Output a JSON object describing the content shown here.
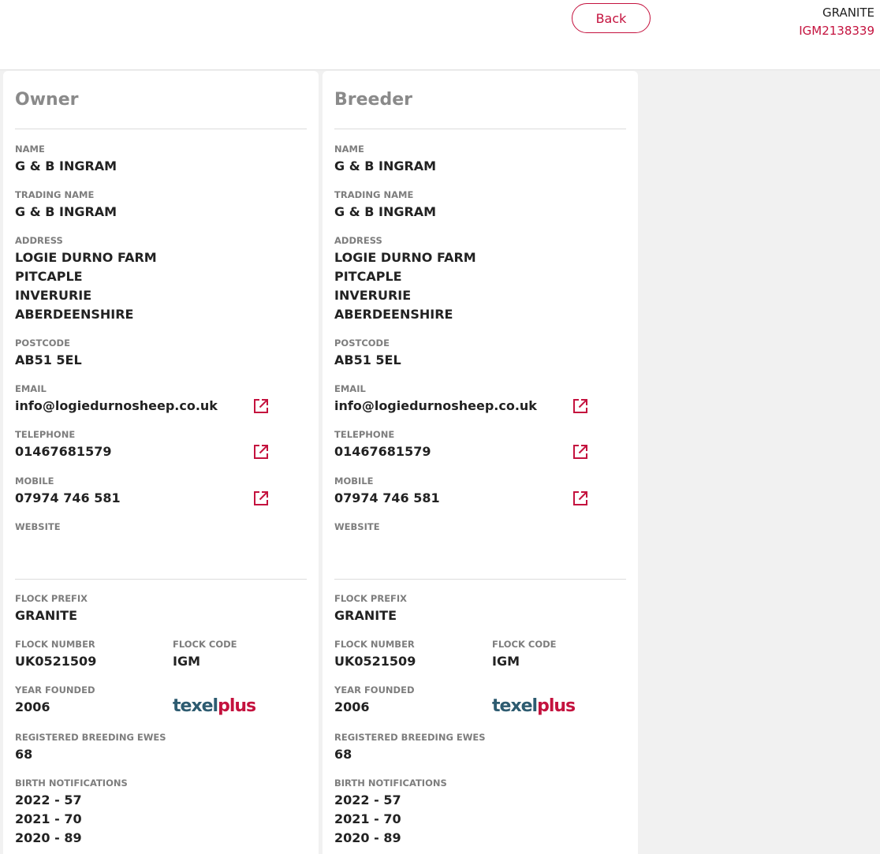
{
  "header": {
    "back_label": "Back",
    "animal_name": "GRANITE",
    "animal_id": "IGM2138339"
  },
  "labels": {
    "name": "NAME",
    "trading_name": "TRADING NAME",
    "address": "ADDRESS",
    "postcode": "POSTCODE",
    "email": "EMAIL",
    "telephone": "TELEPHONE",
    "mobile": "MOBILE",
    "website": "WEBSITE",
    "flock_prefix": "FLOCK PREFIX",
    "flock_number": "FLOCK NUMBER",
    "flock_code": "FLOCK CODE",
    "year_founded": "YEAR FOUNDED",
    "registered_breeding_ewes": "REGISTERED BREEDING EWES",
    "birth_notifications": "BIRTH NOTIFICATIONS"
  },
  "owner": {
    "title": "Owner",
    "name": "G & B INGRAM",
    "trading_name": "G & B INGRAM",
    "address": [
      "LOGIE DURNO FARM",
      "PITCAPLE",
      "INVERURIE",
      "ABERDEENSHIRE"
    ],
    "postcode": "AB51 5EL",
    "email": "info@logiedurnosheep.co.uk",
    "telephone": "01467681579",
    "mobile": "07974 746 581",
    "website": "",
    "flock_prefix": "GRANITE",
    "flock_number": "UK0521509",
    "flock_code": "IGM",
    "year_founded": "2006",
    "logo_text_a": "texel",
    "logo_text_b": "plus",
    "registered_breeding_ewes": "68",
    "birth_notifications": [
      "2022 - 57",
      "2021 - 70",
      "2020 - 89"
    ]
  },
  "breeder": {
    "title": "Breeder",
    "name": "G & B INGRAM",
    "trading_name": "G & B INGRAM",
    "address": [
      "LOGIE DURNO FARM",
      "PITCAPLE",
      "INVERURIE",
      "ABERDEENSHIRE"
    ],
    "postcode": "AB51 5EL",
    "email": "info@logiedurnosheep.co.uk",
    "telephone": "01467681579",
    "mobile": "07974 746 581",
    "website": "",
    "flock_prefix": "GRANITE",
    "flock_number": "UK0521509",
    "flock_code": "IGM",
    "year_founded": "2006",
    "logo_text_a": "texel",
    "logo_text_b": "plus",
    "registered_breeding_ewes": "68",
    "birth_notifications": [
      "2022 - 57",
      "2021 - 70",
      "2020 - 89"
    ]
  },
  "colors": {
    "accent": "#c4123e",
    "logo_dark": "#2d5b70",
    "label_grey": "#7d7d7d",
    "title_grey": "#8a8a8a"
  },
  "icons": {
    "external_link": "external-link-icon"
  }
}
